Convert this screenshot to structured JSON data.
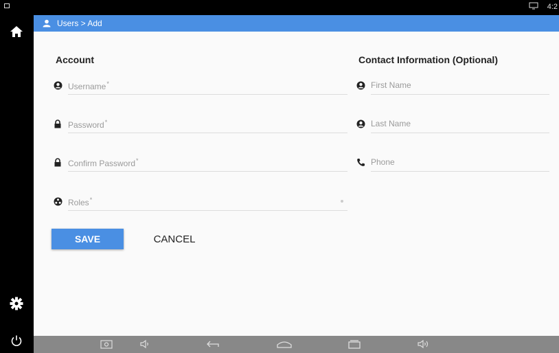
{
  "status": {
    "clock": "4:2"
  },
  "header": {
    "breadcrumb": "Users > Add"
  },
  "account": {
    "title": "Account",
    "fields": [
      {
        "placeholder": "Username",
        "required": "*",
        "icon": "user-circle-icon"
      },
      {
        "placeholder": "Password",
        "required": "*",
        "icon": "lock-icon"
      },
      {
        "placeholder": "Confirm Password",
        "required": "*",
        "icon": "lock-icon"
      },
      {
        "placeholder": "Roles",
        "required": "*",
        "icon": "roles-icon"
      }
    ]
  },
  "contact": {
    "title": "Contact Information (Optional)",
    "fields": [
      {
        "placeholder": "First Name",
        "icon": "user-circle-icon"
      },
      {
        "placeholder": "Last Name",
        "icon": "user-circle-icon"
      },
      {
        "placeholder": "Phone",
        "icon": "phone-icon"
      }
    ]
  },
  "actions": {
    "save": "SAVE",
    "cancel": "CANCEL"
  },
  "colors": {
    "accent": "#4a8fe3",
    "background": "#fafafa",
    "navbar": "#888888"
  }
}
